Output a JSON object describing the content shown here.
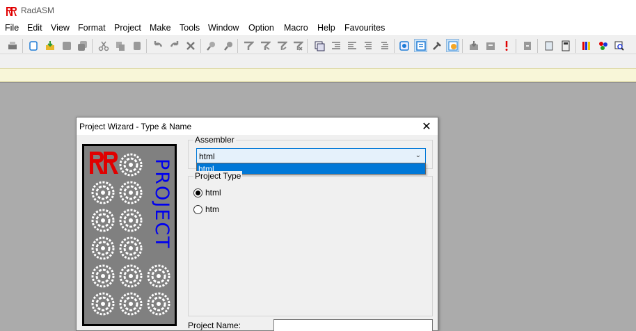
{
  "app": {
    "title": "RadASM"
  },
  "menu": [
    "File",
    "Edit",
    "View",
    "Format",
    "Project",
    "Make",
    "Tools",
    "Window",
    "Option",
    "Macro",
    "Help",
    "Favourites"
  ],
  "toolbar": {
    "buttons": [
      "print",
      "new",
      "open-save",
      "close",
      "close-all",
      "cut",
      "copy",
      "paste",
      "undo",
      "redo",
      "delete",
      "find",
      "replace",
      "toggle-bookmark",
      "next-bookmark",
      "prev-bookmark",
      "clear-bookmarks",
      "block-comment",
      "indent",
      "outdent",
      "align",
      "uncomment",
      "project-browser",
      "output-window",
      "build",
      "run",
      "assemble",
      "link",
      "error",
      "goto",
      "notepad",
      "calculator",
      "color",
      "palette",
      "search-files"
    ],
    "pressed": [
      "output-window",
      "run"
    ]
  },
  "dialog": {
    "title": "Project Wizard - Type & Name",
    "picture_text": "PROJECT",
    "assembler": {
      "label": "Assembler",
      "selected": "html",
      "options": [
        "html"
      ]
    },
    "project_type": {
      "label": "Project Type",
      "options": [
        {
          "label": "html",
          "checked": true
        },
        {
          "label": "htm",
          "checked": false
        }
      ]
    },
    "project_name": {
      "label": "Project Name:",
      "value": ""
    }
  },
  "colors": {
    "logo_red": "#e00000",
    "picture_text": "#0000ee",
    "selection": "#0078d7",
    "workspace": "#ababab"
  }
}
